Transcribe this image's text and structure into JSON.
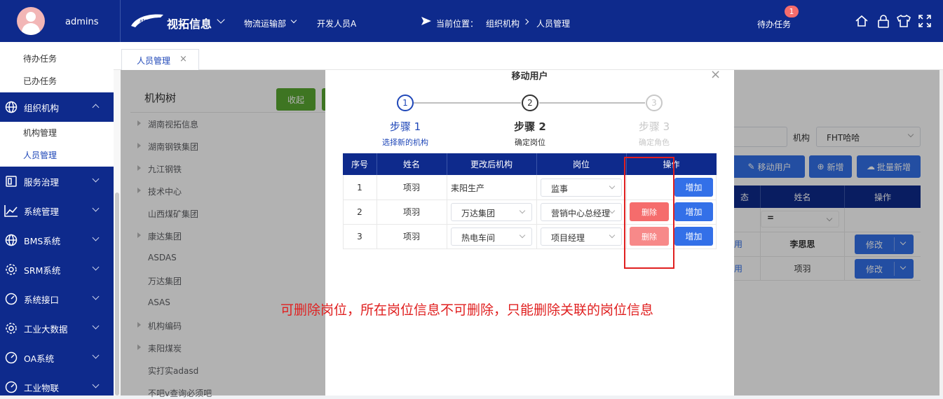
{
  "header": {
    "username": "admins",
    "brand": "视拓信息",
    "dept": "物流运输部",
    "user_dropdown": "开发人员A",
    "location_label": "当前位置：",
    "crumb1": "组织机构",
    "crumb2": "人员管理",
    "todo_label": "待办任务",
    "todo_badge": "1"
  },
  "sidebar": {
    "sub1_item1": "待办任务",
    "sub1_item2": "已办任务",
    "org_menu": "组织机构",
    "sub2_item1": "机构管理",
    "sub2_item2": "人员管理",
    "menus": [
      "服务治理",
      "系统管理",
      "BMS系统",
      "SRM系统",
      "系统接口",
      "工业大数据",
      "OA系统",
      "工业物联"
    ]
  },
  "tabs": {
    "active": "人员管理"
  },
  "bg": {
    "tree_title": "机构树",
    "collapse_btn": "收起",
    "tree": [
      "湖南视拓信息",
      "湖南钢铁集团",
      "九江钢铁",
      "技术中心",
      "山西煤矿集团",
      "康达集团",
      "ASDAS",
      "万达集团",
      "ASAS",
      "机构编码",
      "耒阳煤炭",
      "实打实adasd",
      "不吧v查询必须吧"
    ],
    "org_label": "机构",
    "org_value": "FHT哈哈",
    "move_btn": "移动用户",
    "add_btn": "新增",
    "batch_btn": "批量新增",
    "col_status": "态",
    "col_name": "姓名",
    "col_ops": "操作",
    "filter_eq": "=",
    "row1_status": "用",
    "row1_name": "李思思",
    "row2_status": "用",
    "row2_name": "项羽",
    "edit_btn": "修改"
  },
  "modal": {
    "title": "移动用户",
    "steps": [
      {
        "num": "1",
        "title": "步骤 1",
        "desc": "选择新的机构"
      },
      {
        "num": "2",
        "title": "步骤 2",
        "desc": "确定岗位"
      },
      {
        "num": "3",
        "title": "步骤 3",
        "desc": "确定角色"
      }
    ],
    "headers": [
      "序号",
      "姓名",
      "更改后机构",
      "岗位",
      "操作"
    ],
    "rows": [
      {
        "no": "1",
        "name": "项羽",
        "org": "耒阳生产",
        "post": "监事"
      },
      {
        "no": "2",
        "name": "项羽",
        "org": "万达集团",
        "post": "营销中心总经理"
      },
      {
        "no": "3",
        "name": "项羽",
        "org": "热电车间",
        "post": "项目经理"
      }
    ],
    "delete_btn": "删除",
    "add_btn": "增加"
  },
  "annotation": "可删除岗位，所在岗位信息不可删除，只能删除关联的岗位信息",
  "colors": {
    "nav": "#0e2a8c",
    "primary": "#3370e8",
    "danger": "#f56c6c",
    "green": "#5aa832",
    "annotation": "#e02020"
  }
}
